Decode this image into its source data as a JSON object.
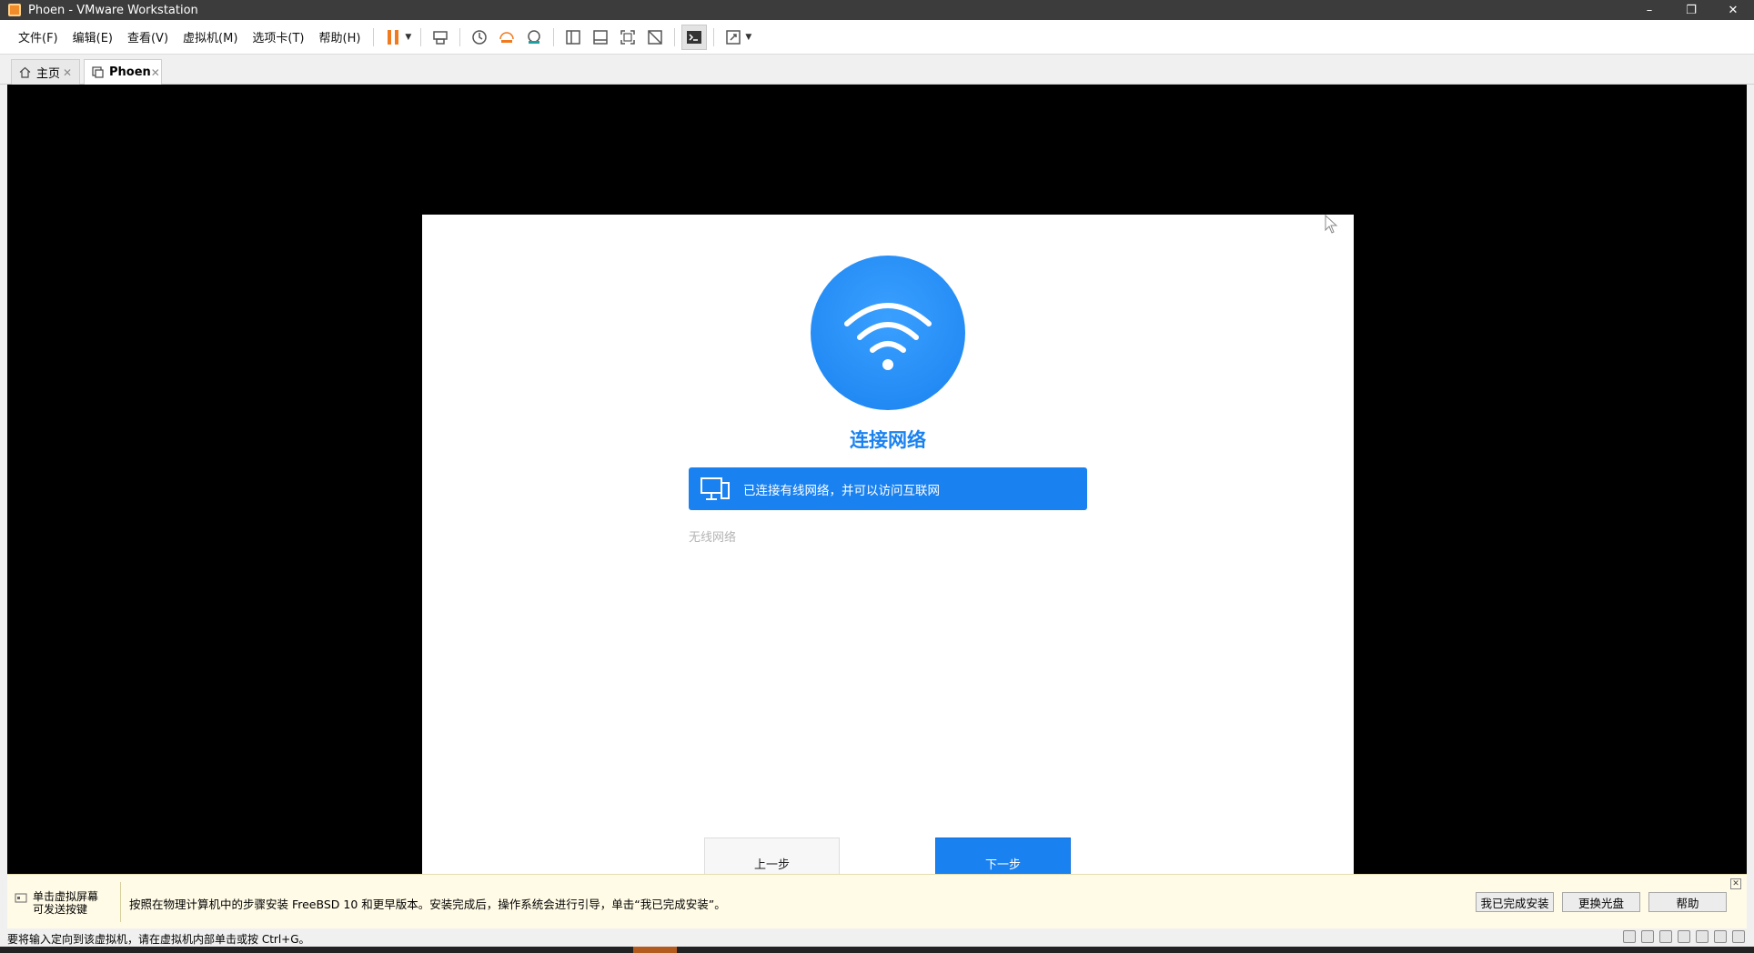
{
  "window": {
    "title": "Phoen - VMware Workstation",
    "controls": {
      "minimize": "–",
      "restore": "❐",
      "close": "✕"
    }
  },
  "menu": [
    {
      "label": "文件(F)"
    },
    {
      "label": "编辑(E)"
    },
    {
      "label": "查看(V)"
    },
    {
      "label": "虚拟机(M)"
    },
    {
      "label": "选项卡(T)"
    },
    {
      "label": "帮助(H)"
    }
  ],
  "toolbar_icons": [
    "pause-icon",
    "send-ctrl-alt-del-icon",
    "snapshot-icon",
    "revert-snapshot-icon",
    "snapshot-manager-icon",
    "library-icon",
    "thumbnail-icon",
    "fullscreen-icon",
    "unity-icon",
    "console-icon",
    "stretch-icon"
  ],
  "tabs": [
    {
      "label": "主页",
      "icon": "home-icon",
      "close": "✕"
    },
    {
      "label": "Phoen",
      "icon": "vm-icon",
      "close": "✕"
    }
  ],
  "setup": {
    "title": "连接网络",
    "wired_status": "已连接有线网络，并可以访问互联网",
    "wireless_label": "无线网络",
    "prev_button": "上一步",
    "next_button": "下一步",
    "accent_color": "#1a82f0"
  },
  "hint": {
    "left_text": "单击虚拟屏幕可发送按键",
    "message": "按照在物理计算机中的步骤安装 FreeBSD 10 和更早版本。安装完成后，操作系统会进行引导，单击“我已完成安装”。",
    "done_button": "我已完成安装",
    "change_disc_button": "更换光盘",
    "help_button": "帮助",
    "close": "✕"
  },
  "status": {
    "text": "要将输入定向到该虚拟机，请在虚拟机内部单击或按 Ctrl+G。"
  }
}
